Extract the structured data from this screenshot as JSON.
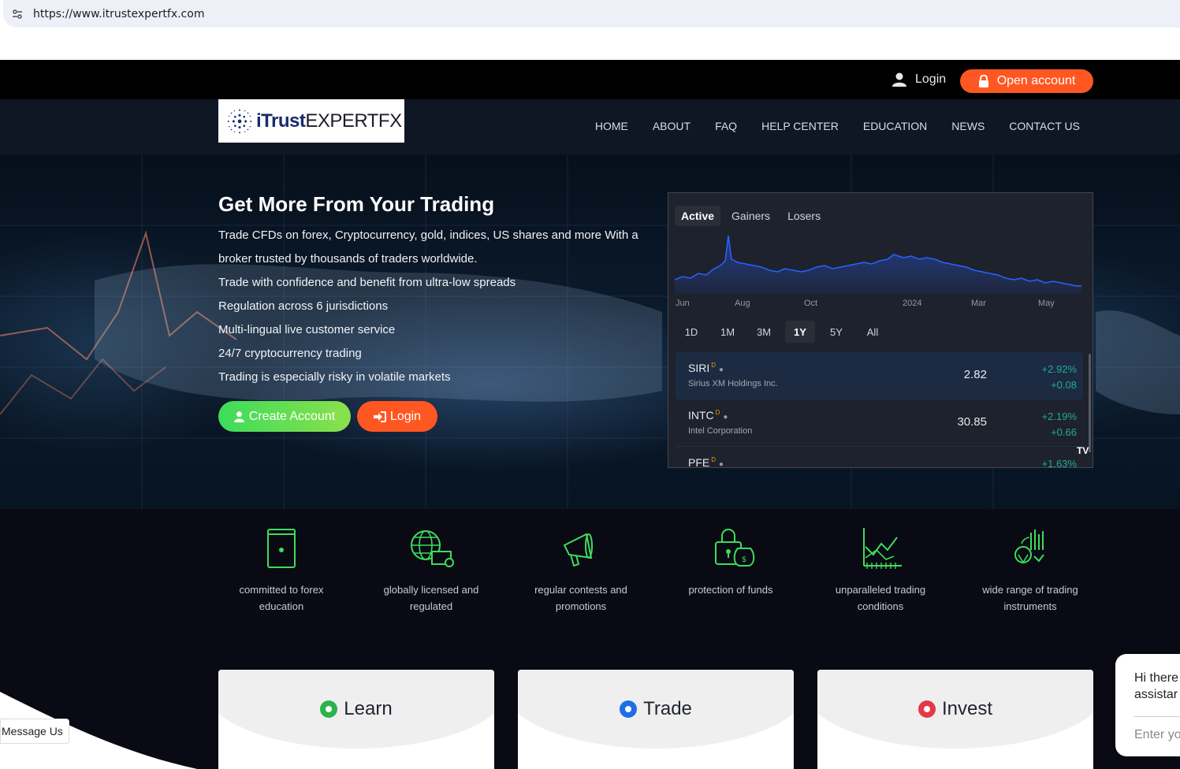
{
  "browser": {
    "url": "https://www.itrustexpertfx.com"
  },
  "topbar": {
    "login_label": "Login",
    "open_account_label": "Open account"
  },
  "logo": {
    "part1": "iTrust",
    "part2": "EXPERTFX"
  },
  "nav": {
    "items": [
      "HOME",
      "ABOUT",
      "FAQ",
      "HELP CENTER",
      "EDUCATION",
      "NEWS",
      "CONTACT US"
    ]
  },
  "hero": {
    "title": "Get More From Your Trading",
    "lines": [
      "Trade CFDs on forex, Cryptocurrency, gold, indices, US shares and more With a broker trusted by thousands of traders worldwide.",
      "Trade with confidence and benefit from ultra-low spreads",
      "Regulation across 6 jurisdictions",
      "Multi-lingual live customer service",
      "24/7 cryptocurrency trading",
      "Trading is especially risky in volatile markets"
    ],
    "create_account_label": "Create Account",
    "login_label": "Login"
  },
  "widget": {
    "tabs": [
      "Active",
      "Gainers",
      "Losers"
    ],
    "active_tab": "Active",
    "x_labels": [
      "Jun",
      "Aug",
      "Oct",
      "2024",
      "Mar",
      "May"
    ],
    "ranges": [
      "1D",
      "1M",
      "3M",
      "1Y",
      "5Y",
      "All"
    ],
    "active_range": "1Y",
    "rows": [
      {
        "symbol": "SIRI",
        "flag": "D",
        "name": "Sirius XM Holdings Inc.",
        "price": "2.82",
        "change_pct": "+2.92%",
        "change": "+0.08"
      },
      {
        "symbol": "INTC",
        "flag": "D",
        "name": "Intel Corporation",
        "price": "30.85",
        "change_pct": "+2.19%",
        "change": "+0.66"
      },
      {
        "symbol": "PFE",
        "flag": "D",
        "name": "",
        "price": "",
        "change_pct": "+1.63%",
        "change": ""
      }
    ],
    "badge": "TV",
    "colors": {
      "line": "#2962ff",
      "positive": "#22ab94"
    }
  },
  "features": [
    {
      "icon": "book-icon",
      "label": "committed to forex education"
    },
    {
      "icon": "globe-license-icon",
      "label": "globally licensed and regulated"
    },
    {
      "icon": "megaphone-icon",
      "label": "regular contests and promotions"
    },
    {
      "icon": "lock-money-icon",
      "label": "protection of funds"
    },
    {
      "icon": "trading-chart-icon",
      "label": "unparalleled trading conditions"
    },
    {
      "icon": "instruments-icon",
      "label": "wide range of trading instruments"
    }
  ],
  "cards": [
    {
      "title": "Learn",
      "color": "#2bb24c"
    },
    {
      "title": "Trade",
      "color": "#1d6fe6"
    },
    {
      "title": "Invest",
      "color": "#e53946"
    }
  ],
  "message_us": "Message Us",
  "chat": {
    "greeting": "Hi there\nassistar",
    "placeholder": "Enter yo"
  },
  "colors": {
    "accent_orange": "#ff5722",
    "accent_green": "#3ddc5b",
    "icon_green": "#3ddc5b"
  }
}
